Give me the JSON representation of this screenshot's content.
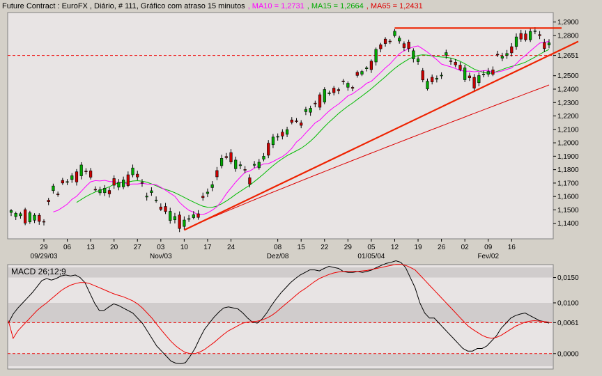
{
  "header": {
    "title": "Future Contract : EuroFX , Diário, # 111, Gráfico com atraso 15 minutos",
    "ma10_label": ", MA10 = 1,2731",
    "ma15_label": ", MA15 = 1,2664",
    "ma65_label": ", MA65 = 1,2431"
  },
  "colors": {
    "background": "#d4d0c8",
    "panel": "#e8e4e4",
    "band": "#d0cccc",
    "up": "#00aa00",
    "down": "#cc0000",
    "ma10": "#ff00ff",
    "ma15": "#00bb00",
    "ma65": "#dd0000",
    "trendline": "#ee2200",
    "macd": "#000000",
    "signal": "#ee0000"
  },
  "chart_data": [
    {
      "type": "candlestick",
      "panel": "price",
      "ylim": [
        1.13,
        1.295
      ],
      "y_ticks": [
        "1,2900",
        "1,2800",
        "1,2651",
        "1,2500",
        "1,2400",
        "1,2300",
        "1,2200",
        "1,2100",
        "1,2000",
        "1,1900",
        "1,1800",
        "1,1700",
        "1,1600",
        "1,1500",
        "1,1400"
      ],
      "y_tick_values": [
        1.29,
        1.28,
        1.2651,
        1.25,
        1.24,
        1.23,
        1.22,
        1.21,
        1.2,
        1.19,
        1.18,
        1.17,
        1.16,
        1.15,
        1.14
      ],
      "highlight_level": "1,2651",
      "x_ticks": [
        "29",
        "06",
        "13",
        "20",
        "27",
        "03",
        "10",
        "17",
        "24",
        "08",
        "15",
        "22",
        "29",
        "05",
        "12",
        "19",
        "26",
        "02",
        "09",
        "16"
      ],
      "x_tick_index": [
        7,
        12,
        17,
        22,
        27,
        32,
        37,
        42,
        47,
        57,
        62,
        67,
        72,
        77,
        82,
        87,
        92,
        97,
        102,
        107
      ],
      "x_sublabels": [
        "09/29/03",
        "Nov/03",
        "Dez/08",
        "01/05/04",
        "Fev/02"
      ],
      "x_sublabel_index": [
        7,
        32,
        57,
        77,
        102
      ],
      "series": [
        {
          "name": "MA10",
          "color": "#ff00ff"
        },
        {
          "name": "MA15",
          "color": "#00bb00"
        },
        {
          "name": "MA65",
          "color": "#dd0000"
        }
      ],
      "trendlines": [
        {
          "from": [
            37,
            1.135
          ],
          "to": [
            115,
            1.2651
          ]
        },
        {
          "from": [
            82,
            1.2855
          ],
          "to": [
            115,
            1.2855
          ]
        }
      ]
    },
    {
      "type": "line",
      "panel": "indicator",
      "title": "MACD 26;12;9",
      "ylim": [
        -0.0025,
        0.017
      ],
      "y_ticks": [
        "0,0150",
        "0,0100",
        "0,0061",
        "0,0000"
      ],
      "y_tick_values": [
        0.015,
        0.01,
        0.0061,
        0.0
      ],
      "highlight_level": "0,0061",
      "series": [
        {
          "name": "MACD",
          "values": [
            0.006,
            0.0078,
            0.009,
            0.01,
            0.011,
            0.012,
            0.0132,
            0.0144,
            0.0148,
            0.0145,
            0.0148,
            0.0153,
            0.0155,
            0.0153,
            0.0155,
            0.015,
            0.014,
            0.012,
            0.01,
            0.0085,
            0.0085,
            0.0092,
            0.0098,
            0.0095,
            0.009,
            0.0085,
            0.008,
            0.007,
            0.006,
            0.0045,
            0.003,
            0.0015,
            0.0005,
            -0.0005,
            -0.0015,
            -0.0019,
            -0.002,
            -0.0018,
            -0.0005,
            0.001,
            0.003,
            0.0048,
            0.006,
            0.0072,
            0.0082,
            0.009,
            0.0092,
            0.009,
            0.0088,
            0.008,
            0.007,
            0.0062,
            0.006,
            0.0068,
            0.008,
            0.0095,
            0.0108,
            0.012,
            0.013,
            0.014,
            0.0148,
            0.0155,
            0.016,
            0.0165,
            0.0165,
            0.0163,
            0.0168,
            0.0172,
            0.017,
            0.0168,
            0.0162,
            0.016,
            0.016,
            0.0162,
            0.016,
            0.0162,
            0.0165,
            0.017,
            0.0174,
            0.0178,
            0.018,
            0.0183,
            0.018,
            0.017,
            0.015,
            0.013,
            0.01,
            0.008,
            0.007,
            0.007,
            0.006,
            0.005,
            0.004,
            0.003,
            0.002,
            0.001,
            0.0005,
            0.0005,
            0.001,
            0.001,
            0.0015,
            0.0025,
            0.0035,
            0.005,
            0.006,
            0.007,
            0.0075,
            0.0078,
            0.008,
            0.0075,
            0.007,
            0.0065,
            0.0063,
            0.006
          ]
        },
        {
          "name": "Signal",
          "values": [
            0.0065,
            0.003,
            0.0045,
            0.0055,
            0.0065,
            0.0075,
            0.0085,
            0.0093,
            0.01,
            0.0108,
            0.0116,
            0.0124,
            0.013,
            0.0135,
            0.0138,
            0.014,
            0.014,
            0.0138,
            0.0134,
            0.013,
            0.0126,
            0.0122,
            0.0118,
            0.0115,
            0.0112,
            0.0108,
            0.0104,
            0.0098,
            0.009,
            0.008,
            0.007,
            0.0058,
            0.0046,
            0.0035,
            0.0024,
            0.0015,
            0.0008,
            0.0002,
            0.0,
            0.0,
            0.0003,
            0.0008,
            0.0015,
            0.0022,
            0.003,
            0.0038,
            0.0045,
            0.005,
            0.0055,
            0.006,
            0.0062,
            0.0063,
            0.0064,
            0.0066,
            0.007,
            0.0075,
            0.0082,
            0.009,
            0.0098,
            0.0106,
            0.0114,
            0.0122,
            0.0128,
            0.0135,
            0.0142,
            0.0148,
            0.0152,
            0.0156,
            0.0159,
            0.0161,
            0.0162,
            0.0162,
            0.0162,
            0.0162,
            0.0163,
            0.0164,
            0.0166,
            0.0168,
            0.017,
            0.0172,
            0.0174,
            0.0176,
            0.0176,
            0.0174,
            0.017,
            0.0165,
            0.0155,
            0.0145,
            0.0135,
            0.0125,
            0.0115,
            0.0105,
            0.0095,
            0.0085,
            0.0075,
            0.0065,
            0.0055,
            0.0048,
            0.0042,
            0.0036,
            0.0032,
            0.003,
            0.0032,
            0.0036,
            0.0042,
            0.0048,
            0.0054,
            0.0058,
            0.0062,
            0.0064,
            0.0065,
            0.0064,
            0.0063,
            0.0062
          ]
        }
      ]
    }
  ]
}
